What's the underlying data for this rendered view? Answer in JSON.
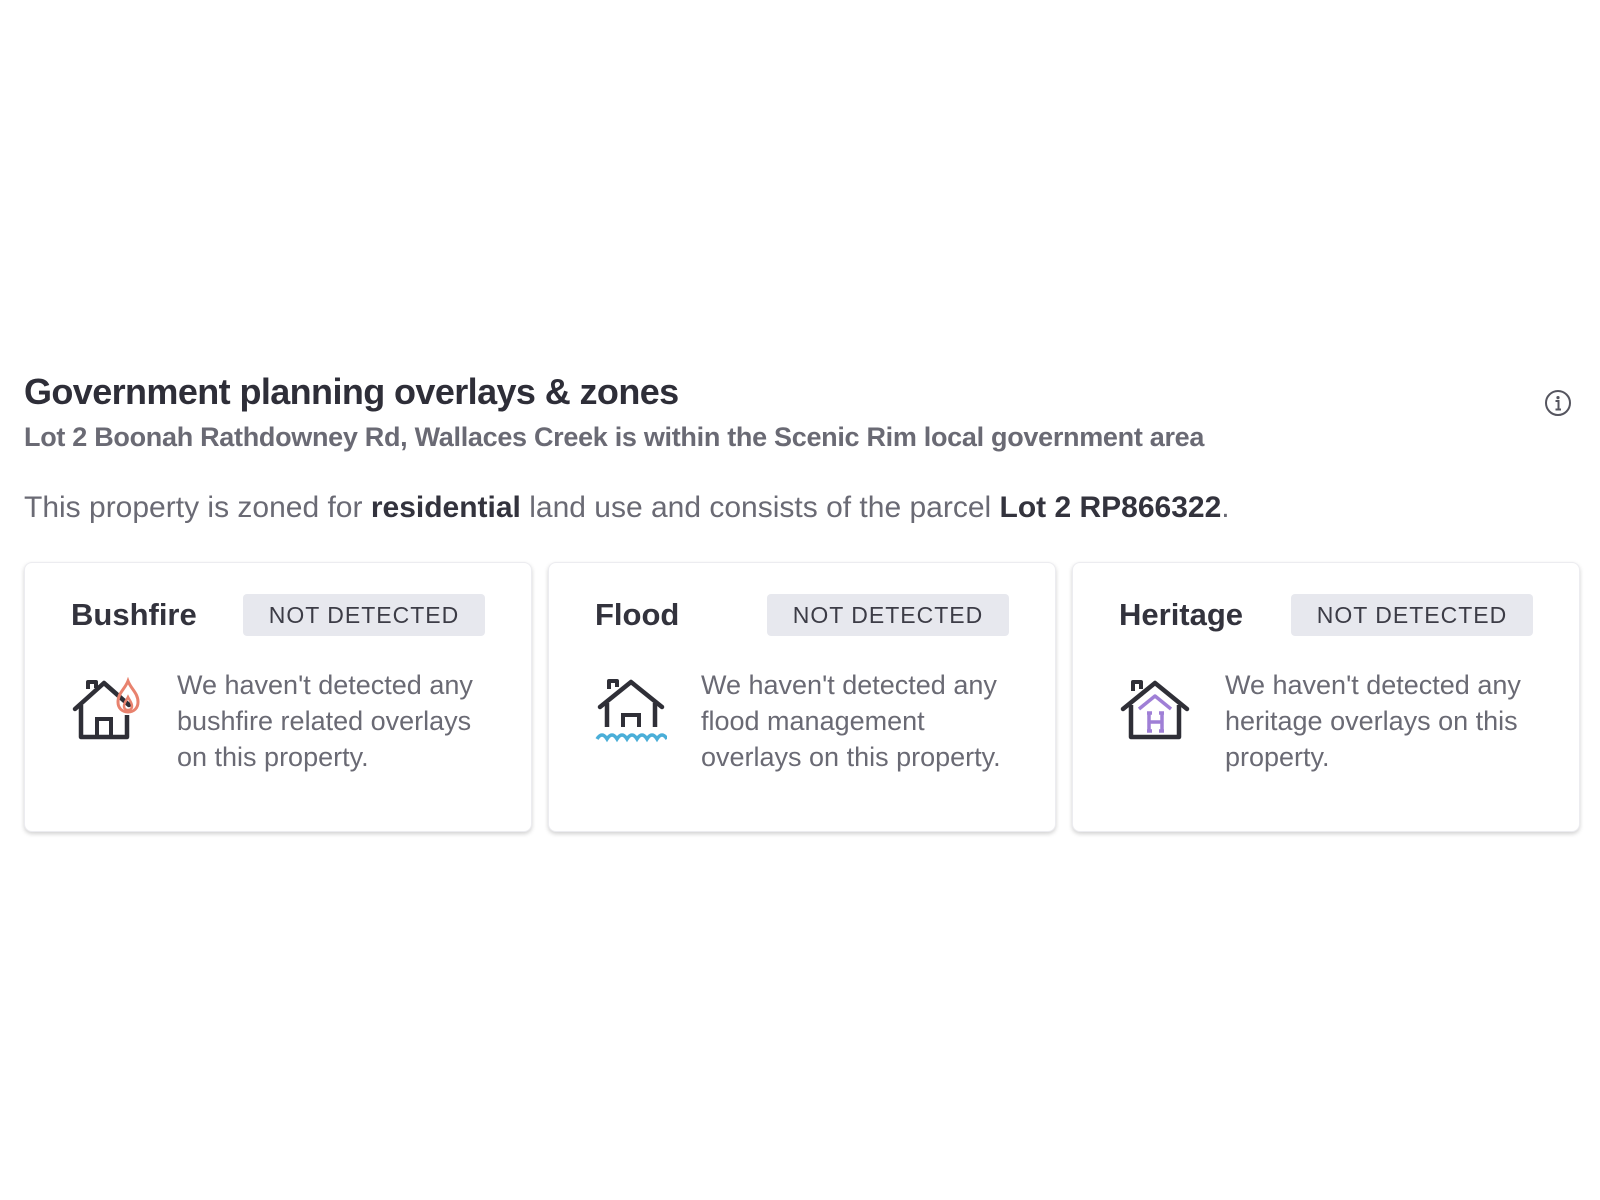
{
  "section": {
    "title": "Government planning overlays & zones",
    "subtitle": "Lot 2 Boonah Rathdowney Rd, Wallaces Creek is within the Scenic Rim local government area",
    "info_icon": "info-icon",
    "zoning": {
      "prefix": "This property is zoned for ",
      "zone": "residential",
      "middle": " land use and consists of the parcel ",
      "parcel": "Lot 2 RP866322",
      "suffix": "."
    }
  },
  "cards": [
    {
      "title": "Bushfire",
      "status": "NOT DETECTED",
      "icon": "house-fire-icon",
      "text": "We haven't detected any bushfire related overlays on this property."
    },
    {
      "title": "Flood",
      "status": "NOT DETECTED",
      "icon": "house-flood-icon",
      "text": "We haven't detected any flood management overlays on this property."
    },
    {
      "title": "Heritage",
      "status": "NOT DETECTED",
      "icon": "house-heritage-icon",
      "text": "We haven't detected any heritage overlays on this property."
    }
  ],
  "colors": {
    "fire": "#e8826e",
    "water": "#4aaed8",
    "heritage": "#9f7fd6",
    "icon_stroke": "#2f2f37"
  }
}
